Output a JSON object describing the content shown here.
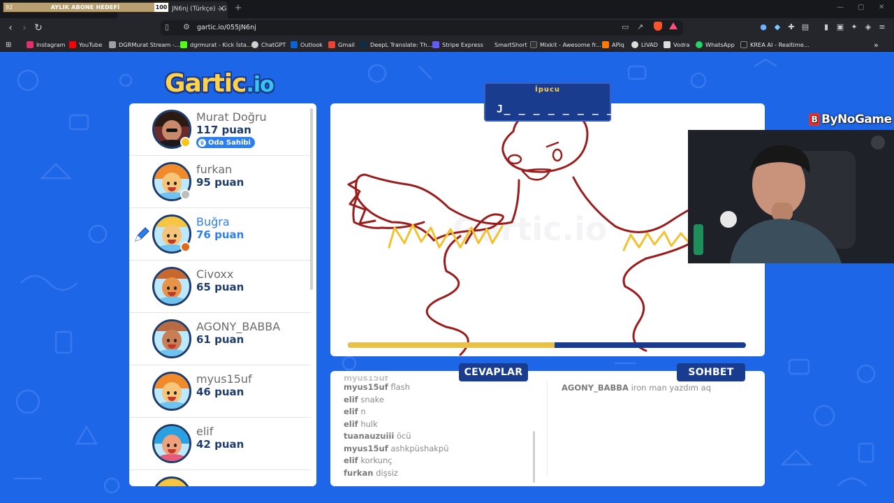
{
  "stream_overlay": {
    "current": "92",
    "label": "AYLIK ABONE HEDEFİ",
    "goal": "100"
  },
  "browser": {
    "tab_title": "JN6nj (Türkçe) - G",
    "url": "gartic.io/055JN6nj",
    "bookmarks": [
      {
        "label": "Instagram",
        "color": "#e1306c"
      },
      {
        "label": "YouTube",
        "color": "#ff0000"
      },
      {
        "label": "DGRMurat Stream -...",
        "color": "#9aa0a6"
      },
      {
        "label": "dgrmurat - Kick İsta...",
        "color": "#53fc18"
      },
      {
        "label": "ChatGPT",
        "color": "#d0d0d0"
      },
      {
        "label": "Outlook",
        "color": "#0a64d6"
      },
      {
        "label": "Gmail",
        "color": "#ea4335"
      },
      {
        "label": "DeepL Translate: Th...",
        "color": "#0f2b46"
      },
      {
        "label": "Stripe Express",
        "color": "#635bff"
      },
      {
        "label": "SmartShort",
        "color": "#24262b"
      },
      {
        "label": "Mixkit - Awesome fr...",
        "color": "#333"
      },
      {
        "label": "APiq",
        "color": "#ff7a00"
      },
      {
        "label": "LIVAD",
        "color": "#ddd"
      },
      {
        "label": "Vodra",
        "color": "#ddd"
      },
      {
        "label": "WhatsApp",
        "color": "#25d366"
      },
      {
        "label": "KREA AI - Realtime...",
        "color": "#222"
      }
    ]
  },
  "game": {
    "logo_main": "Gartic",
    "logo_io": ".io",
    "hint_title": "İpucu",
    "hint_word": "J_ _ _ _ _ _ _ _ _ _",
    "timer_remaining": 0.52,
    "answers_tab": "CEVAPLAR",
    "chat_tab": "SOHBET",
    "owner_badge": "Oda Sahibi",
    "players": [
      {
        "name": "Murat Doğru",
        "points": "117 puan",
        "owner": true,
        "drawing": false,
        "dot": "#f5c518",
        "hair": "#2a1a12",
        "skin": "#c98a6b",
        "shirt": "#8a1c1c"
      },
      {
        "name": "furkan",
        "points": "95 puan",
        "owner": false,
        "drawing": false,
        "dot": "#bdbdbd",
        "hair": "#f08a2a",
        "skin": "#f7c57a",
        "shirt": "#6fc3f0"
      },
      {
        "name": "Buğra",
        "points": "76 puan",
        "owner": false,
        "drawing": true,
        "dot": "#e06a1a",
        "hair": "#f6c542",
        "skin": "#f7c57a",
        "shirt": "#6fc3f0"
      },
      {
        "name": "Civoxx",
        "points": "65 puan",
        "owner": false,
        "drawing": false,
        "dot": "",
        "hair": "#e8934a",
        "skin": "#e8934a",
        "shirt": "#6fc3f0"
      },
      {
        "name": "AGONY_BABBA",
        "points": "61 puan",
        "owner": false,
        "drawing": false,
        "dot": "",
        "hair": "#b86a43",
        "skin": "#c97e55",
        "shirt": "#6fc3f0"
      },
      {
        "name": "myus15uf",
        "points": "46 puan",
        "owner": false,
        "drawing": false,
        "dot": "",
        "hair": "#f08a2a",
        "skin": "#f7c57a",
        "shirt": "#6fc3f0"
      },
      {
        "name": "elif",
        "points": "42 puan",
        "owner": false,
        "drawing": false,
        "dot": "",
        "hair": "#2aa0e0",
        "skin": "#f0a07a",
        "shirt": "#e85a7a"
      }
    ],
    "answers": [
      {
        "user": "myus15uf",
        "text": "flash"
      },
      {
        "user": "elif",
        "text": "snake"
      },
      {
        "user": "elif",
        "text": "n"
      },
      {
        "user": "elif",
        "text": "hulk"
      },
      {
        "user": "tuanauzuiii",
        "text": "öcü"
      },
      {
        "user": "myus15uf",
        "text": "ashkpüshakpü"
      },
      {
        "user": "elif",
        "text": "korkunç"
      },
      {
        "user": "furkan",
        "text": "dişsiz"
      }
    ],
    "chat": [
      {
        "user": "AGONY_BABBA",
        "text": "iron man yazdım aq"
      }
    ]
  },
  "overlay_brand": "ByNoGame"
}
